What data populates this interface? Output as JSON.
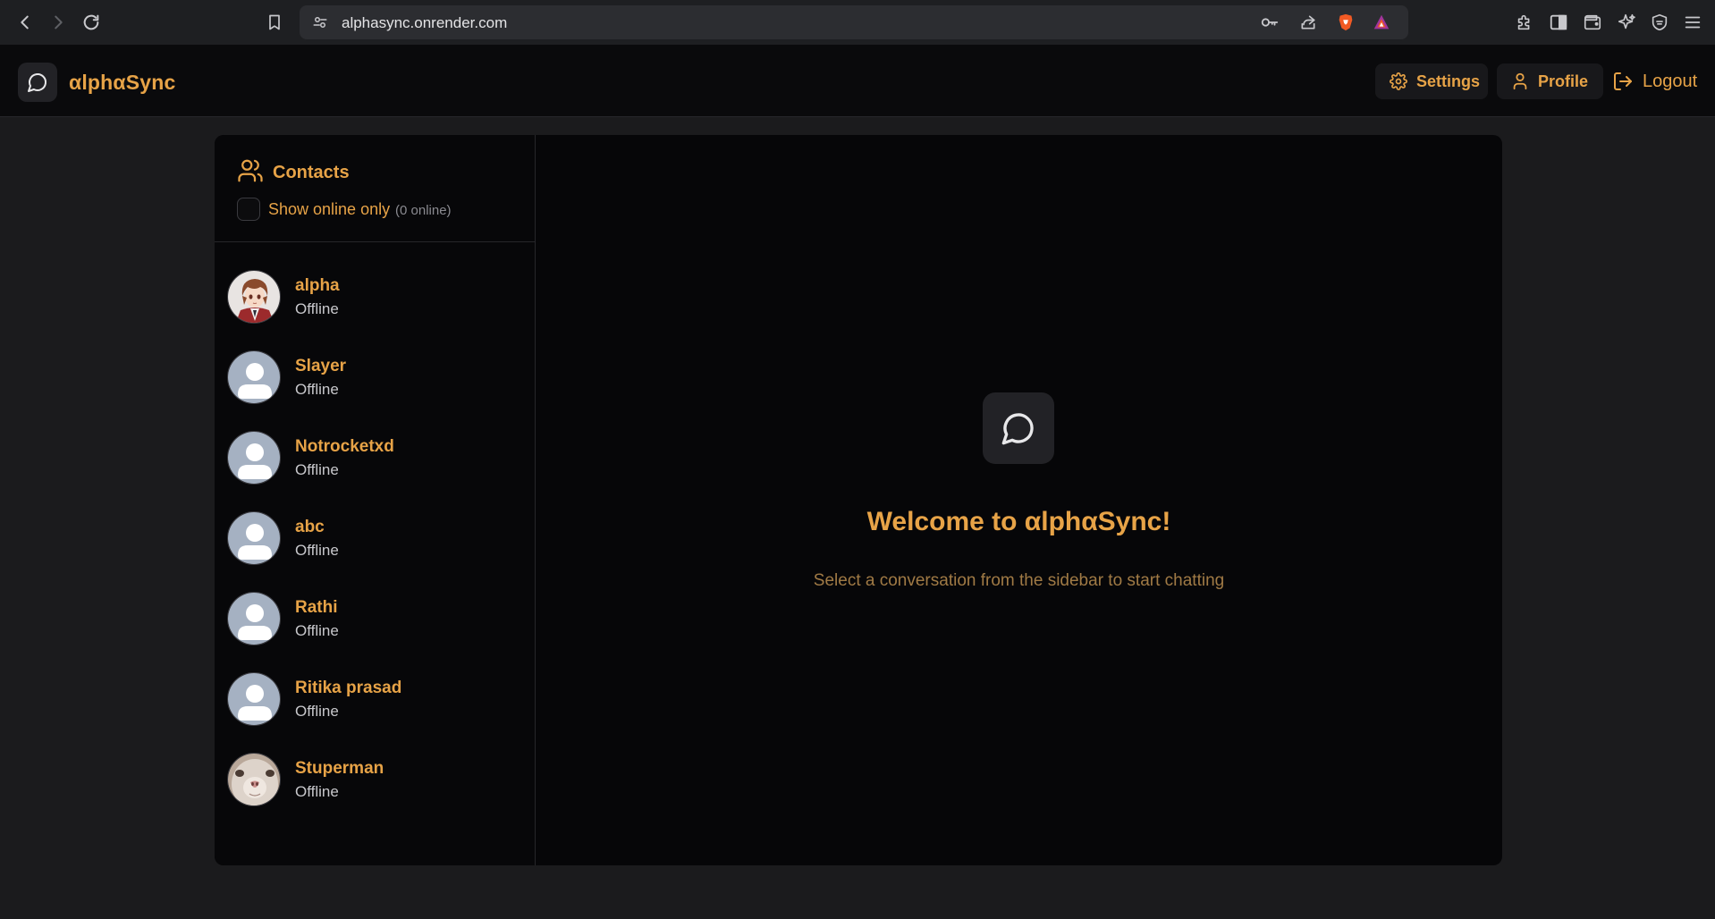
{
  "browser": {
    "url": "alphasync.onrender.com"
  },
  "app": {
    "brand": "αlphαSync",
    "settings_label": "Settings",
    "profile_label": "Profile",
    "logout_label": "Logout",
    "accent_color": "#e7a347"
  },
  "sidebar": {
    "title": "Contacts",
    "show_online_label": "Show online only",
    "online_count": "(0 online)",
    "contacts": [
      {
        "name": "alpha",
        "status": "Offline",
        "avatar": "anime-character-avatar"
      },
      {
        "name": "Slayer",
        "status": "Offline",
        "avatar": "default-user-avatar"
      },
      {
        "name": "Notrocketxd",
        "status": "Offline",
        "avatar": "default-user-avatar"
      },
      {
        "name": "abc",
        "status": "Offline",
        "avatar": "default-user-avatar"
      },
      {
        "name": "Rathi",
        "status": "Offline",
        "avatar": "default-user-avatar"
      },
      {
        "name": "Ritika prasad",
        "status": "Offline",
        "avatar": "default-user-avatar"
      },
      {
        "name": "Stuperman",
        "status": "Offline",
        "avatar": "cat-photo-avatar"
      }
    ]
  },
  "welcome": {
    "title": "Welcome to αlphαSync!",
    "subtitle": "Select a conversation from the sidebar to start chatting"
  }
}
